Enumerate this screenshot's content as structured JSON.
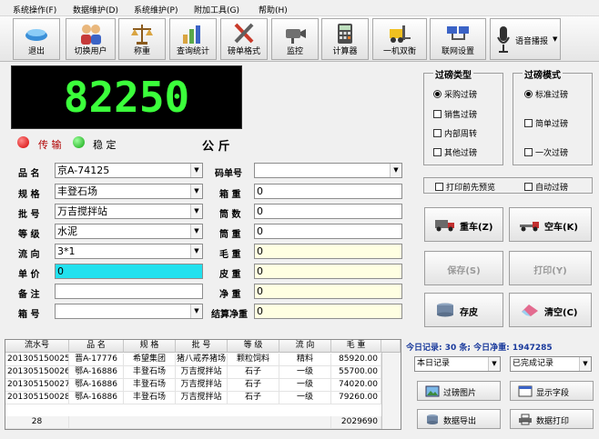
{
  "menu": [
    "系统操作(F)",
    "数据维护(D)",
    "系统维护(P)",
    "附加工具(G)",
    "帮助(H)"
  ],
  "toolbar": {
    "exit": "退出",
    "switch_user": "切换用户",
    "weigh": "称重",
    "query_stats": "查询统计",
    "format": "磅单格式",
    "monitor": "监控",
    "calculator": "计算器",
    "dual_balance": "一机双衡",
    "network_settings": "联网设置",
    "voice_broadcast": "语音播报"
  },
  "display": {
    "weight": "82250",
    "unit": "公 斤",
    "status_transfer": "传 输",
    "status_stable": "稳 定"
  },
  "form": {
    "product_label": "品 名",
    "product_value": "京A-74125",
    "spec_label": "规 格",
    "spec_value": "丰登石场",
    "batch_label": "批 号",
    "batch_value": "万吉搅拌站",
    "grade_label": "等 级",
    "grade_value": "水泥",
    "direction_label": "流 向",
    "direction_value": "3*1",
    "price_label": "单 价",
    "price_value": "0",
    "note_label": "备 注",
    "note_value": "",
    "box_no_label": "箱 号",
    "box_no_value": "",
    "code_label": "码单号",
    "code_value": "",
    "box_weight_label": "箱 重",
    "box_weight_value": "0",
    "drum_count_label": "筒 数",
    "drum_count_value": "0",
    "drum_weight_label": "筒 重",
    "drum_weight_value": "0",
    "gross_label": "毛 重",
    "gross_value": "0",
    "tare_label": "皮 重",
    "tare_value": "0",
    "net_label": "净 重",
    "net_value": "0",
    "settle_net_label": "结算净重",
    "settle_net_value": "0"
  },
  "weigh_type": {
    "title": "过磅类型",
    "options": [
      "采购过磅",
      "销售过磅",
      "内部周转",
      "其他过磅"
    ],
    "selected": "采购过磅"
  },
  "weigh_mode": {
    "title": "过磅模式",
    "options": [
      "标准过磅",
      "简单过磅",
      "一次过磅"
    ],
    "selected": "标准过磅"
  },
  "checks": {
    "preview_before_print": "打印前先预览",
    "auto_weigh": "自动过磅"
  },
  "actions": {
    "heavy_car": "重车(Z)",
    "empty_car": "空车(K)",
    "save": "保存(S)",
    "print": "打印(Y)",
    "store_tare": "存皮",
    "clear": "清空(C)"
  },
  "summary": "今日记录: 30 条; 今日净重: 1947285",
  "filters": {
    "records": "本日记录",
    "status": "已完成记录"
  },
  "bottom_buttons": {
    "weigh_photo": "过磅图片",
    "show_fields": "显示字段",
    "export": "数据导出",
    "print_data": "数据打印"
  },
  "table": {
    "headers": [
      "流水号",
      "品 名",
      "规 格",
      "批 号",
      "等 级",
      "流 向",
      "毛 重"
    ],
    "rows": [
      [
        "201305150025",
        "晋A-17776",
        "希望集团",
        "猪八戒养猪场",
        "颗粒饲料",
        "精料",
        "85920.00"
      ],
      [
        "201305150026",
        "鄂A-16886",
        "丰登石场",
        "万吉搅拌站",
        "石子",
        "一级",
        "55700.00"
      ],
      [
        "201305150027",
        "鄂A-16886",
        "丰登石场",
        "万吉搅拌站",
        "石子",
        "一级",
        "74020.00"
      ],
      [
        "201305150028",
        "鄂A-16886",
        "丰登石场",
        "万吉搅拌站",
        "石子",
        "一级",
        "79260.00"
      ]
    ],
    "footer_count": "28",
    "footer_total": "2029690"
  },
  "colors": {
    "display_digits": "#3bff3b",
    "price_field": "#22e1ee",
    "weight_fields": "#ffffe2",
    "summary_text": "#1a3a9c"
  }
}
